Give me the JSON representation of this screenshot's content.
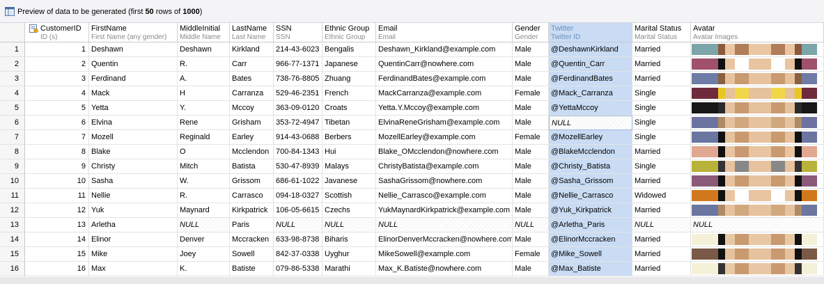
{
  "title_bar": {
    "prefix": "Preview of data to be generated (first ",
    "first_count": "50",
    "middle": " rows of ",
    "total_count": "1000",
    "suffix": ")"
  },
  "columns": [
    {
      "key": "id",
      "title": "CustomerID",
      "subtitle": "ID (s)"
    },
    {
      "key": "first",
      "title": "FirstName",
      "subtitle": "First Name (any gender)"
    },
    {
      "key": "middle",
      "title": "MiddleInitial",
      "subtitle": "Middle Name"
    },
    {
      "key": "last",
      "title": "LastName",
      "subtitle": "Last Name"
    },
    {
      "key": "ssn",
      "title": "SSN",
      "subtitle": "SSN"
    },
    {
      "key": "ethnic",
      "title": "Ethnic Group",
      "subtitle": "Ethnic Group"
    },
    {
      "key": "email",
      "title": "Email",
      "subtitle": "Email"
    },
    {
      "key": "gender",
      "title": "Gender",
      "subtitle": "Gender"
    },
    {
      "key": "twitter",
      "title": "Twitter",
      "subtitle": "Twitter ID"
    },
    {
      "key": "marital",
      "title": "Marital Status",
      "subtitle": "Marital Status"
    },
    {
      "key": "avatar",
      "title": "Avatar",
      "subtitle": "Avatar Images"
    }
  ],
  "null_label": "NULL",
  "rows": [
    {
      "n": "1",
      "id": "1",
      "first": "Deshawn",
      "middle": "Deshawn",
      "last": "Kirkland",
      "ssn": "214-43-6023",
      "ethnic": "Bengalis",
      "email": "Deshawn_Kirkland@example.com",
      "gender": "Male",
      "twitter": "@DeshawnKirkland",
      "marital": "Married",
      "avatar": {
        "bg": "#7ba5a9",
        "skin": "#eac7a2",
        "hair": "#8a5a3a",
        "accent": "#b07d58"
      }
    },
    {
      "n": "2",
      "id": "2",
      "first": "Quentin",
      "middle": "R.",
      "last": "Carr",
      "ssn": "966-77-1371",
      "ethnic": "Japanese",
      "email": "QuentinCarr@nowhere.com",
      "gender": "Male",
      "twitter": "@Quentin_Carr",
      "marital": "Married",
      "avatar": {
        "bg": "#a0526b",
        "skin": "#e8c4a0",
        "hair": "#111111",
        "accent": "#ffffff"
      }
    },
    {
      "n": "3",
      "id": "3",
      "first": "Ferdinand",
      "middle": "A.",
      "last": "Bates",
      "ssn": "738-76-8805",
      "ethnic": "Zhuang",
      "email": "FerdinandBates@example.com",
      "gender": "Male",
      "twitter": "@FerdinandBates",
      "marital": "Married",
      "avatar": {
        "bg": "#6d7ba6",
        "skin": "#e6c29e",
        "hair": "#8a6040",
        "accent": "#c99a70"
      }
    },
    {
      "n": "4",
      "id": "4",
      "first": "Mack",
      "middle": "H",
      "last": "Carranza",
      "ssn": "529-46-2351",
      "ethnic": "French",
      "email": "MackCarranza@example.com",
      "gender": "Female",
      "twitter": "@Mack_Carranza",
      "marital": "Single",
      "avatar": {
        "bg": "#6f2b3b",
        "skin": "#e5c19c",
        "hair": "#e8c820",
        "accent": "#f2d64a"
      }
    },
    {
      "n": "5",
      "id": "5",
      "first": "Yetta",
      "middle": "Y.",
      "last": "Mccoy",
      "ssn": "363-09-0120",
      "ethnic": "Croats",
      "email": "Yetta.Y.Mccoy@example.com",
      "gender": "Male",
      "twitter": "@YettaMccoy",
      "marital": "Single",
      "avatar": {
        "bg": "#171717",
        "skin": "#e5c19c",
        "hair": "#2a2a2a",
        "accent": "#c99a70"
      }
    },
    {
      "n": "6",
      "id": "6",
      "first": "Elvina",
      "middle": "Rene",
      "last": "Grisham",
      "ssn": "353-72-4947",
      "ethnic": "Tibetan",
      "email": "ElvinaReneGrisham@example.com",
      "gender": "Male",
      "twitter": null,
      "marital": "Single",
      "avatar": {
        "bg": "#6c73a0",
        "skin": "#e6c29e",
        "hair": "#b08a64",
        "accent": "#d1a87e"
      }
    },
    {
      "n": "7",
      "id": "7",
      "first": "Mozell",
      "middle": "Reginald",
      "last": "Earley",
      "ssn": "914-43-0688",
      "ethnic": "Berbers",
      "email": "MozellEarley@example.com",
      "gender": "Female",
      "twitter": "@MozellEarley",
      "marital": "Single",
      "avatar": {
        "bg": "#6a76a0",
        "skin": "#e6c29e",
        "hair": "#111111",
        "accent": "#c99a70"
      }
    },
    {
      "n": "8",
      "id": "8",
      "first": "Blake",
      "middle": "O",
      "last": "Mcclendon",
      "ssn": "700-84-1343",
      "ethnic": "Hui",
      "email": "Blake_OMcclendon@nowhere.com",
      "gender": "Male",
      "twitter": "@BlakeMcclendon",
      "marital": "Married",
      "avatar": {
        "bg": "#e0a890",
        "skin": "#e8c4a0",
        "hair": "#111111",
        "accent": "#c99a70"
      }
    },
    {
      "n": "9",
      "id": "9",
      "first": "Christy",
      "middle": "Mitch",
      "last": "Batista",
      "ssn": "530-47-8939",
      "ethnic": "Malays",
      "email": "ChristyBatista@example.com",
      "gender": "Male",
      "twitter": "@Christy_Batista",
      "marital": "Single",
      "avatar": {
        "bg": "#b9b23a",
        "skin": "#e6c29e",
        "hair": "#333333",
        "accent": "#888888"
      }
    },
    {
      "n": "10",
      "id": "10",
      "first": "Sasha",
      "middle": "W.",
      "last": "Grissom",
      "ssn": "686-61-1022",
      "ethnic": "Javanese",
      "email": "SashaGrissom@nowhere.com",
      "gender": "Male",
      "twitter": "@Sasha_Grissom",
      "marital": "Married",
      "avatar": {
        "bg": "#8a5a78",
        "skin": "#e6c29e",
        "hair": "#111111",
        "accent": "#c99a70"
      }
    },
    {
      "n": "11",
      "id": "11",
      "first": "Nellie",
      "middle": "R.",
      "last": "Carrasco",
      "ssn": "094-18-0327",
      "ethnic": "Scottish",
      "email": "Nellie_Carrasco@example.com",
      "gender": "Male",
      "twitter": "@Nellie_Carrasco",
      "marital": "Widowed",
      "avatar": {
        "bg": "#d2781c",
        "skin": "#e8c4a0",
        "hair": "#111111",
        "accent": "#ffffff"
      }
    },
    {
      "n": "12",
      "id": "12",
      "first": "Yuk",
      "middle": "Maynard",
      "last": "Kirkpatrick",
      "ssn": "106-05-6615",
      "ethnic": "Czechs",
      "email": "YukMaynardKirkpatrick@example.com",
      "gender": "Male",
      "twitter": "@Yuk_Kirkpatrick",
      "marital": "Married",
      "avatar": {
        "bg": "#6a76a0",
        "skin": "#e6c29e",
        "hair": "#b08a64",
        "accent": "#d1a87e"
      }
    },
    {
      "n": "13",
      "id": "13",
      "first": "Arletha",
      "middle": null,
      "last": "Paris",
      "ssn": null,
      "ethnic": null,
      "email": null,
      "gender": null,
      "twitter": "@Arletha_Paris",
      "marital": null,
      "avatar": null
    },
    {
      "n": "14",
      "id": "14",
      "first": "Elinor",
      "middle": "Denver",
      "last": "Mccracken",
      "ssn": "633-98-8738",
      "ethnic": "Biharis",
      "email": "ElinorDenverMccracken@nowhere.com",
      "gender": "Male",
      "twitter": "@ElinorMccracken",
      "marital": "Married",
      "avatar": {
        "bg": "#f5f0d8",
        "skin": "#e8c8a4",
        "hair": "#111111",
        "accent": "#c99a70"
      }
    },
    {
      "n": "15",
      "id": "15",
      "first": "Mike",
      "middle": "Joey",
      "last": "Sowell",
      "ssn": "842-37-0338",
      "ethnic": "Uyghur",
      "email": "MikeSowell@example.com",
      "gender": "Female",
      "twitter": "@Mike_Sowell",
      "marital": "Married",
      "avatar": {
        "bg": "#7a5a46",
        "skin": "#e6c29e",
        "hair": "#111111",
        "accent": "#c99a70"
      }
    },
    {
      "n": "16",
      "id": "16",
      "first": "Max",
      "middle": "K.",
      "last": "Batiste",
      "ssn": "079-86-5338",
      "ethnic": "Marathi",
      "email": "Max_K.Batiste@nowhere.com",
      "gender": "Male",
      "twitter": "@Max_Batiste",
      "marital": "Married",
      "avatar": {
        "bg": "#f5f0d8",
        "skin": "#e8c8a4",
        "hair": "#333333",
        "accent": "#c99a70"
      }
    }
  ]
}
